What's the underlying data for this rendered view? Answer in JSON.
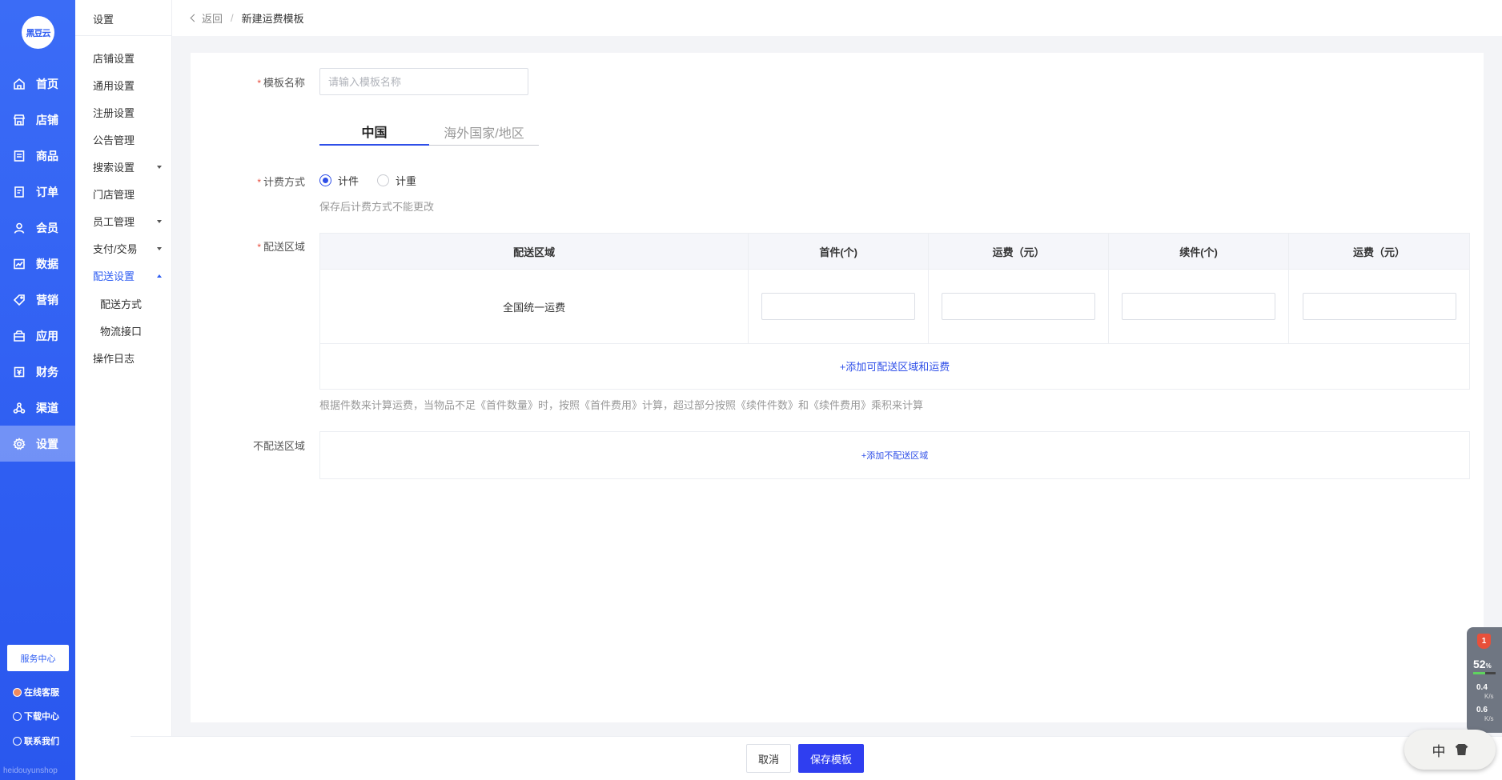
{
  "brand": {
    "logo_text": "黑豆云",
    "footer_text": "heidouyunshop"
  },
  "nav": {
    "items": [
      {
        "label": "首页",
        "icon": "home-icon"
      },
      {
        "label": "店铺",
        "icon": "store-icon"
      },
      {
        "label": "商品",
        "icon": "goods-icon"
      },
      {
        "label": "订单",
        "icon": "order-icon"
      },
      {
        "label": "会员",
        "icon": "member-icon"
      },
      {
        "label": "数据",
        "icon": "data-icon"
      },
      {
        "label": "营销",
        "icon": "tag-icon"
      },
      {
        "label": "应用",
        "icon": "app-icon"
      },
      {
        "label": "财务",
        "icon": "finance-icon"
      },
      {
        "label": "渠道",
        "icon": "channel-icon"
      },
      {
        "label": "设置",
        "icon": "gear-icon",
        "active": true
      }
    ],
    "service_center": "服务中心",
    "online_support": "在线客服",
    "download_center": "下载中心",
    "contact_us": "联系我们"
  },
  "subnav": {
    "title": "设置",
    "items": [
      {
        "label": "店铺设置"
      },
      {
        "label": "通用设置"
      },
      {
        "label": "注册设置"
      },
      {
        "label": "公告管理"
      },
      {
        "label": "搜索设置",
        "expandable": true
      },
      {
        "label": "门店管理"
      },
      {
        "label": "员工管理",
        "expandable": true
      },
      {
        "label": "支付/交易",
        "expandable": true
      },
      {
        "label": "配送设置",
        "expandable": true,
        "active": true
      },
      {
        "label": "配送方式",
        "child": true
      },
      {
        "label": "物流接口",
        "child": true
      },
      {
        "label": "操作日志"
      }
    ]
  },
  "breadcrumb": {
    "back": "返回",
    "separator": "/",
    "current": "新建运费模板"
  },
  "form": {
    "name_label": "模板名称",
    "name_placeholder": "请输入模板名称",
    "name_value": "",
    "tabs": [
      {
        "label": "中国",
        "active": true
      },
      {
        "label": "海外国家/地区",
        "active": false
      }
    ],
    "billing_label": "计费方式",
    "billing_options": [
      {
        "label": "计件",
        "selected": true
      },
      {
        "label": "计重",
        "selected": false
      }
    ],
    "billing_hint": "保存后计费方式不能更改",
    "area_label": "配送区域",
    "table": {
      "headers": [
        "配送区域",
        "首件(个)",
        "运费（元）",
        "续件(个)",
        "运费（元）"
      ],
      "rows": [
        {
          "region": "全国统一运费",
          "values": [
            "",
            "",
            "",
            ""
          ]
        }
      ]
    },
    "add_area_link": "+添加可配送区域和运费",
    "area_hint": "根据件数来计算运费，当物品不足《首件数量》时，按照《首件费用》计算，超过部分按照《续件件数》和《续件费用》乘积来计算",
    "no_ship_label": "不配送区域",
    "add_no_ship_link": "+添加不配送区域"
  },
  "actions": {
    "cancel": "取消",
    "save": "保存模板"
  },
  "widget": {
    "badge": "1",
    "cpu_percent": "52",
    "cpu_unit": "%",
    "cpu_level": 0.52,
    "up_rate": "0.4",
    "down_rate": "0.6",
    "rate_unit": "K/s",
    "ime_label": "中"
  },
  "colors": {
    "nav_blue": "#2f5ef2",
    "primary": "#2f3ef0",
    "required": "#e74c3c"
  }
}
